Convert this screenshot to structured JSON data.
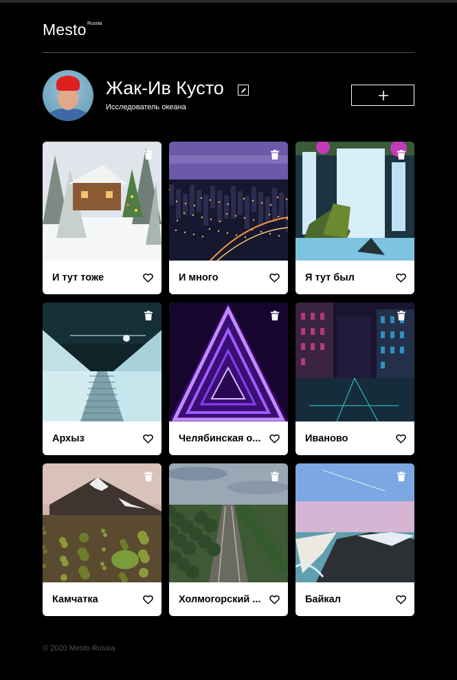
{
  "header": {
    "logo": "Mesto",
    "logo_superscript": "Russia"
  },
  "profile": {
    "name": "Жак-Ив Кусто",
    "about": "Исследователь океана"
  },
  "cards": [
    {
      "title": "И тут тоже",
      "image": "winter-cabin"
    },
    {
      "title": "И много",
      "image": "night-city"
    },
    {
      "title": "Я тут был",
      "image": "waterfall"
    },
    {
      "title": "Архыз",
      "image": "escalator-tunnel"
    },
    {
      "title": "Челябинская о...",
      "image": "neon-triangle"
    },
    {
      "title": "Иваново",
      "image": "night-street"
    },
    {
      "title": "Камчатка",
      "image": "volcano"
    },
    {
      "title": "Холмогорский ...",
      "image": "railway-forest"
    },
    {
      "title": "Байкал",
      "image": "cliff-sea"
    }
  ],
  "icons": {
    "edit": "pencil-icon",
    "add": "plus-icon",
    "delete": "trash-icon",
    "like": "heart-outline-icon"
  },
  "footer": {
    "copyright": "© 2020 Mesto Russia"
  }
}
